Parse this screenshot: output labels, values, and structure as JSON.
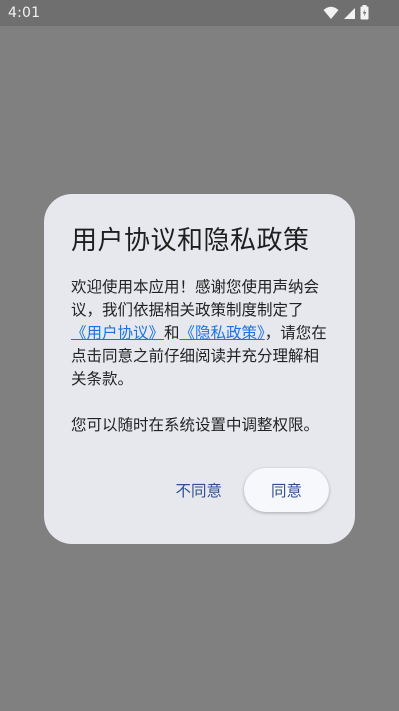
{
  "status_bar": {
    "time": "4:01",
    "icons": [
      "wifi-icon",
      "signal-icon",
      "battery-icon"
    ]
  },
  "dialog": {
    "title": "用户协议和隐私政策",
    "body_prefix": "欢迎使用本应用！感谢您使用声纳会议，我们依据相关政策制度制定了",
    "link_user_agreement": "《用户协议》",
    "and_text": "和",
    "link_privacy_policy": "《隐私政策》",
    "body_suffix": "，请您在点击同意之前仔细阅读并充分理解相关条款。",
    "body_second": "您可以随时在系统设置中调整权限。",
    "disagree_label": "不同意",
    "agree_label": "同意"
  },
  "colors": {
    "scrim": "#808080",
    "dialog_bg": "#e6e8ee",
    "link": "#1a73e8",
    "button_text": "#2f4f8f"
  }
}
